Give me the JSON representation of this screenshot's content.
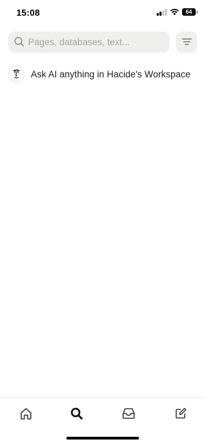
{
  "status_bar": {
    "time": "15:08",
    "battery_level": "64",
    "signal_bars_active": 2,
    "signal_bars_total": 4
  },
  "search": {
    "placeholder": "Pages, databases, text...",
    "value": "",
    "icon": "search-icon",
    "filter_icon": "filter-icon"
  },
  "ask_ai": {
    "label": "Ask AI anything in Hacide's Workspace",
    "icon": "notion-ai-face-icon"
  },
  "tab_bar": {
    "items": [
      {
        "name": "home",
        "icon": "home-icon",
        "active": false
      },
      {
        "name": "search",
        "icon": "search-icon",
        "active": true
      },
      {
        "name": "inbox",
        "icon": "inbox-icon",
        "active": false
      },
      {
        "name": "new-page",
        "icon": "compose-icon",
        "active": false
      }
    ]
  },
  "colors": {
    "background": "#ffffff",
    "search_fill": "#efefed",
    "placeholder": "#a3a3a0",
    "text": "#1f1f1f",
    "icon": "#3a3a3a"
  }
}
